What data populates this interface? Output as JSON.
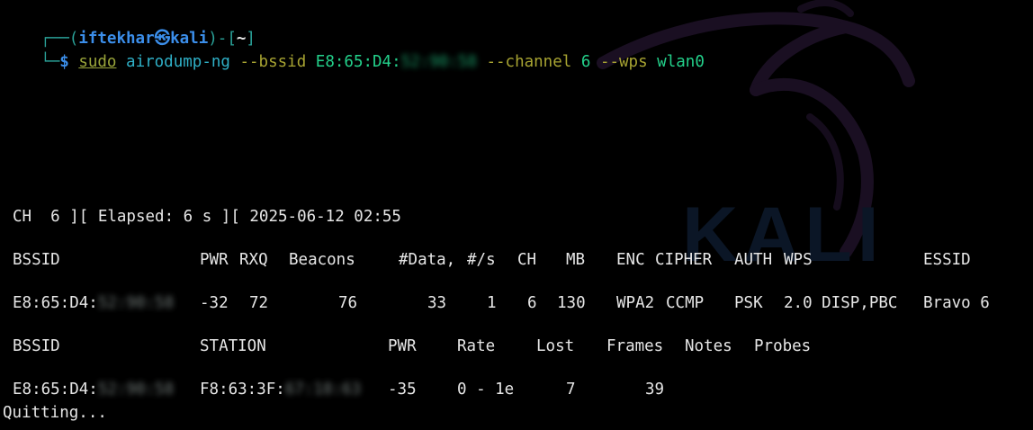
{
  "prompt": {
    "user": "iftekhar",
    "at_glyph": "㉿",
    "host": "kali",
    "cwd": "~",
    "frame_top_left": "┌──(",
    "frame_mid": ")-[",
    "frame_close": "]",
    "frame_bottom": "└─",
    "symbol": "$"
  },
  "command": {
    "sudo": "sudo",
    "program": "airodump-ng",
    "opt_bssid": "--bssid",
    "bssid_value": "E8:65:D4:",
    "bssid_value_hidden": "52:90:58",
    "opt_channel": "--channel",
    "channel_value": "6",
    "opt_wps": "--wps",
    "interface": "wlan0"
  },
  "status_line": "CH  6 ][ Elapsed: 6 s ][ 2025-06-12 02:55",
  "ap_table": {
    "headers": [
      "BSSID",
      "PWR",
      "RXQ",
      "Beacons",
      "#Data,",
      "#/s",
      "CH",
      "MB",
      "ENC",
      "CIPHER",
      "AUTH",
      "WPS",
      "ESSID"
    ],
    "rows": [
      {
        "bssid": "E8:65:D4:",
        "bssid_hidden": "52:90:58",
        "pwr": "-32",
        "rxq": "72",
        "beacons": "76",
        "data": "33",
        "per_s": "1",
        "ch": "6",
        "mb": "130",
        "enc": "WPA2",
        "cipher": "CCMP",
        "auth": "PSK",
        "wps": "2.0 DISP,PBC",
        "essid": "Bravo 6"
      }
    ]
  },
  "station_table": {
    "headers": [
      "BSSID",
      "STATION",
      "PWR",
      "Rate",
      "Lost",
      "Frames",
      "Notes",
      "Probes"
    ],
    "rows": [
      {
        "bssid": "E8:65:D4:",
        "bssid_hidden": "52:90:58",
        "station": "F8:63:3F:",
        "station_hidden": "67:18:63",
        "pwr": "-35",
        "rate": "0 - 1e",
        "lost": "7",
        "frames": "39"
      }
    ]
  },
  "footer": "Quitting...",
  "watermark_text": "KALI"
}
